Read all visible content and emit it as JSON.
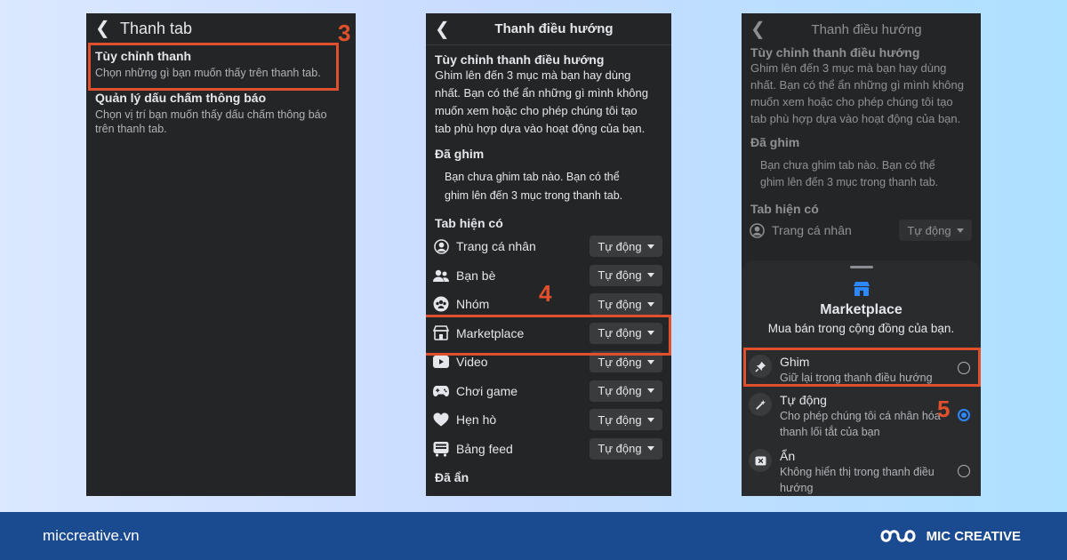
{
  "colors": {
    "accent": "#e0502c",
    "panel_bg": "#242526",
    "footer_bg": "#1a4a8f",
    "selected": "#2d88ff"
  },
  "steps": {
    "step1": "3",
    "step2": "4",
    "step3": "5"
  },
  "screen1": {
    "title": "Thanh tab",
    "items": [
      {
        "title": "Tùy chỉnh thanh",
        "desc": "Chọn những gì bạn muốn thấy trên thanh tab."
      },
      {
        "title": "Quản lý dấu chấm thông báo",
        "desc1": "Chọn vị trí bạn muốn thấy dấu chấm thông báo",
        "desc2": "trên thanh tab."
      }
    ]
  },
  "screen2": {
    "title": "Thanh điều hướng",
    "section": "Tùy chỉnh thanh điều hướng",
    "intro": [
      "Ghim lên đến 3 mục mà bạn hay dùng",
      "nhất. Bạn có thể ẩn những gì mình không",
      "muốn xem hoặc cho phép chúng tôi tạo",
      "tab phù hợp dựa vào hoạt động của bạn."
    ],
    "pinned_title": "Đã ghim",
    "pinned_text": [
      "Bạn chưa ghim tab nào. Bạn có thể",
      "ghim lên đến 3 mục trong thanh tab."
    ],
    "available_title": "Tab hiện có",
    "dropdown_value": "Tự động",
    "tabs": [
      {
        "label": "Trang cá nhân",
        "icon": "profile-icon"
      },
      {
        "label": "Bạn bè",
        "icon": "friends-icon"
      },
      {
        "label": "Nhóm",
        "icon": "groups-icon"
      },
      {
        "label": "Marketplace",
        "icon": "marketplace-icon"
      },
      {
        "label": "Video",
        "icon": "video-icon"
      },
      {
        "label": "Chơi game",
        "icon": "gaming-icon"
      },
      {
        "label": "Hẹn hò",
        "icon": "dating-icon"
      },
      {
        "label": "Bảng feed",
        "icon": "feed-icon"
      }
    ],
    "hidden_title": "Đã ẩn"
  },
  "screen3": {
    "title": "Thanh điều hướng",
    "section": "Tùy chỉnh thanh điều hướng",
    "intro": [
      "Ghim lên đến 3 mục mà bạn hay dùng",
      "nhất. Bạn có thể ẩn những gì mình không",
      "muốn xem hoặc cho phép chúng tôi tạo",
      "tab phù hợp dựa vào hoạt động của bạn."
    ],
    "pinned_title": "Đã ghim",
    "pinned_text": [
      "Bạn chưa ghim tab nào. Bạn có thể",
      "ghim lên đến 3 mục trong thanh tab."
    ],
    "available_title": "Tab hiện có",
    "first_tab": "Trang cá nhân",
    "dropdown_value": "Tự động",
    "sheet": {
      "title": "Marketplace",
      "subtitle": "Mua bán trong cộng đồng của bạn.",
      "options": [
        {
          "title": "Ghim",
          "desc1": "Giữ lại trong thanh điều hướng",
          "selected": false
        },
        {
          "title": "Tự động",
          "desc1": "Cho phép chúng tôi cá nhân hóa",
          "desc2": "thanh lối tắt của bạn",
          "selected": true
        },
        {
          "title": "Ẩn",
          "desc1": "Không hiển thị trong thanh điều",
          "desc2": "hướng",
          "selected": false
        }
      ]
    }
  },
  "footer": {
    "site": "miccreative.vn",
    "brand": "MIC CREATIVE"
  }
}
